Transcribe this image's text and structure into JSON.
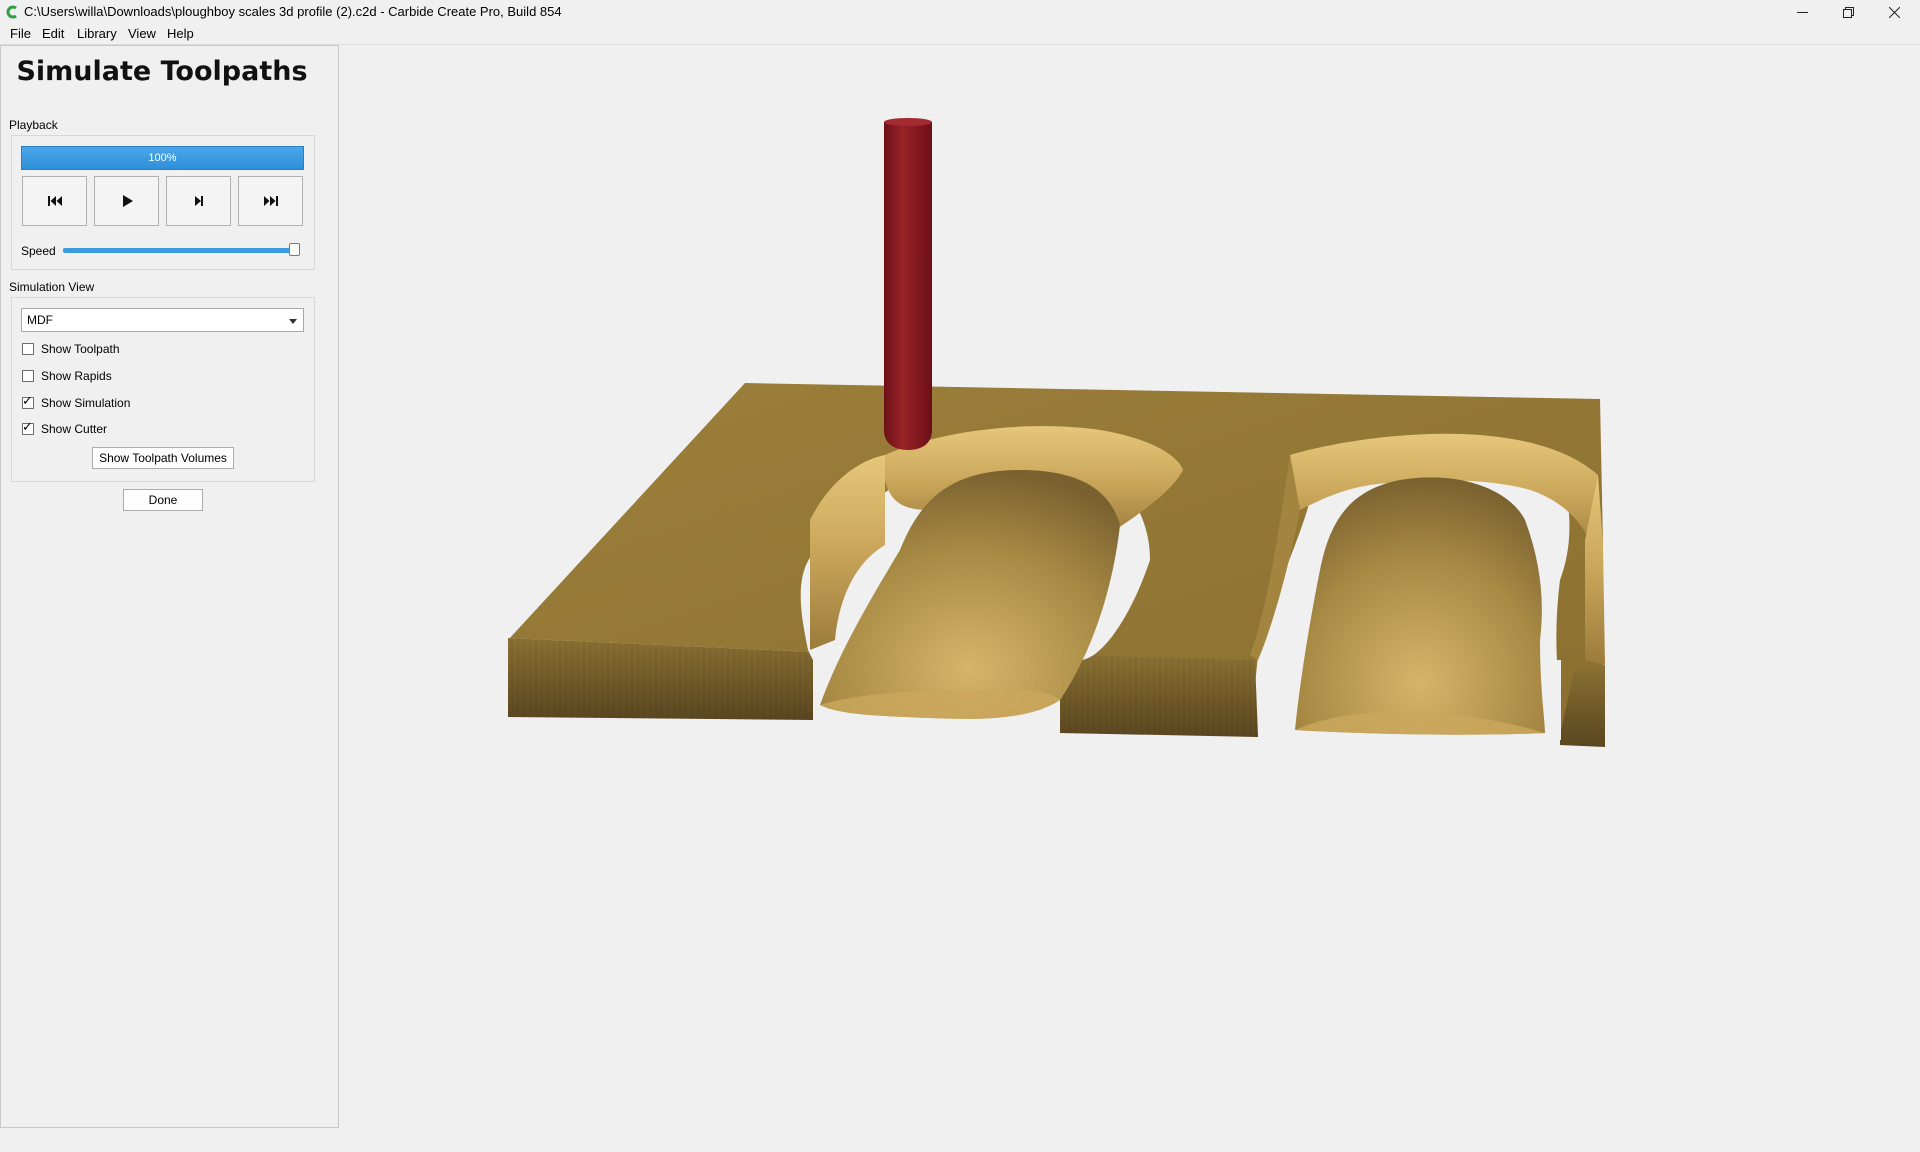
{
  "window": {
    "title": "C:\\Users\\willa\\Downloads\\ploughboy scales 3d profile (2).c2d - Carbide Create Pro, Build 854",
    "controls": [
      "minimize-icon",
      "restore-icon",
      "close-icon"
    ]
  },
  "menu": {
    "items": [
      {
        "label": "File",
        "icon": ""
      },
      {
        "label": "Edit"
      },
      {
        "label": "Library"
      },
      {
        "label": "View"
      },
      {
        "label": "Help"
      }
    ]
  },
  "panel": {
    "title": "Simulate Toolpaths",
    "playback": {
      "label": "Playback",
      "progress_text": "100%",
      "progress_value": 1.0,
      "buttons": [
        "rewind-to-start-icon",
        "play-icon",
        "step-forward-icon",
        "skip-to-end-icon"
      ],
      "speed_label": "Speed",
      "speed_value": 0.98
    },
    "simulation_view": {
      "label": "Simulation View",
      "material_selected": "MDF",
      "checkboxes": [
        {
          "label": "Show Toolpath",
          "checked": false
        },
        {
          "label": "Show Rapids",
          "checked": false
        },
        {
          "label": "Show Simulation",
          "checked": true
        },
        {
          "label": "Show Cutter",
          "checked": true
        }
      ],
      "volumes_button": "Show Toolpath Volumes"
    },
    "done_button": "Done"
  },
  "colors": {
    "accent": "#3c9be0",
    "cutter": "#8b1c22",
    "wood": "#a88a3e"
  }
}
